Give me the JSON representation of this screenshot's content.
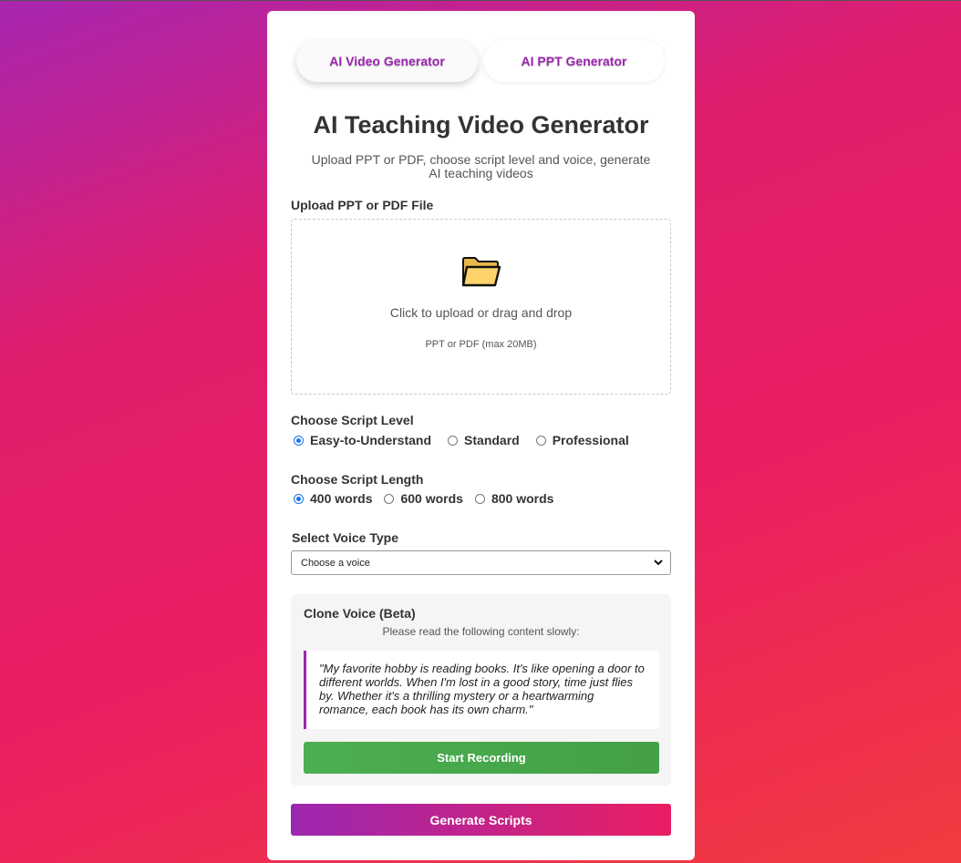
{
  "tabs": [
    {
      "label": "AI Video Generator",
      "active": true
    },
    {
      "label": "AI PPT Generator",
      "active": false
    }
  ],
  "header": {
    "title": "AI Teaching Video Generator",
    "subtitle": "Upload PPT or PDF, choose script level and voice, generate AI teaching videos"
  },
  "upload": {
    "label": "Upload PPT or PDF File",
    "icon": "folder-icon",
    "main_text": "Click to upload or drag and drop",
    "sub_text": "PPT or PDF (max 20MB)"
  },
  "script_level": {
    "label": "Choose Script Level",
    "options": [
      "Easy-to-Understand",
      "Standard",
      "Professional"
    ],
    "selected": "Easy-to-Understand"
  },
  "script_length": {
    "label": "Choose Script Length",
    "options": [
      "400 words",
      "600 words",
      "800 words"
    ],
    "selected": "400 words"
  },
  "voice": {
    "label": "Select Voice Type",
    "selected": "Choose a voice"
  },
  "clone_voice": {
    "title": "Clone Voice (Beta)",
    "hint": "Please read the following content slowly:",
    "quote": "\"My favorite hobby is reading books. It's like opening a door to different worlds. When I'm lost in a good story, time just flies by. Whether it's a thrilling mystery or a heartwarming romance, each book has its own charm.\"",
    "record_label": "Start Recording"
  },
  "generate_label": "Generate Scripts",
  "colors": {
    "accent_purple": "#9c27b0",
    "accent_pink": "#e91e63",
    "record_green": "#4caf50",
    "radio_blue": "#1a73e8"
  }
}
